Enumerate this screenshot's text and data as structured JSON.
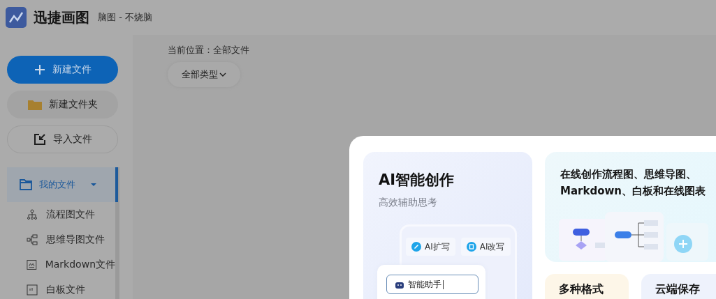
{
  "app": {
    "name": "迅捷画图",
    "subtitle": "脑图 - 不烧脑"
  },
  "sidebar": {
    "actions": [
      {
        "kind": "primary",
        "label": "新建文件"
      },
      {
        "kind": "folder",
        "label": "新建文件夹"
      },
      {
        "kind": "import",
        "label": "导入文件"
      }
    ],
    "nav": [
      {
        "label": "我的文件",
        "selected": true,
        "expanded": true,
        "children": [
          {
            "kind": "flow",
            "label": "流程图文件"
          },
          {
            "kind": "mindmap",
            "label": "思维导图文件"
          },
          {
            "kind": "markdown",
            "label": "Markdown文件"
          },
          {
            "kind": "whiteboard",
            "label": "白板文件"
          }
        ]
      }
    ]
  },
  "main": {
    "breadcrumb": "当前位置：全部文件",
    "filter": "全部类型"
  },
  "dialog": {
    "feature_card": {
      "title": "AI智能创作",
      "subtitle": "高效辅助思考",
      "chips": [
        {
          "kind": "expand",
          "label": "AI扩写"
        },
        {
          "kind": "rewrite",
          "label": "AI改写"
        }
      ],
      "input_value": "智能助手"
    },
    "intro_card": {
      "lines": [
        "在线创作流程图、思维导图、",
        "Markdown、白板和在线图表"
      ]
    },
    "small_cards": [
      {
        "kind": "formats",
        "title": "多种格式"
      },
      {
        "kind": "cloud",
        "title": "云端保存"
      }
    ]
  }
}
